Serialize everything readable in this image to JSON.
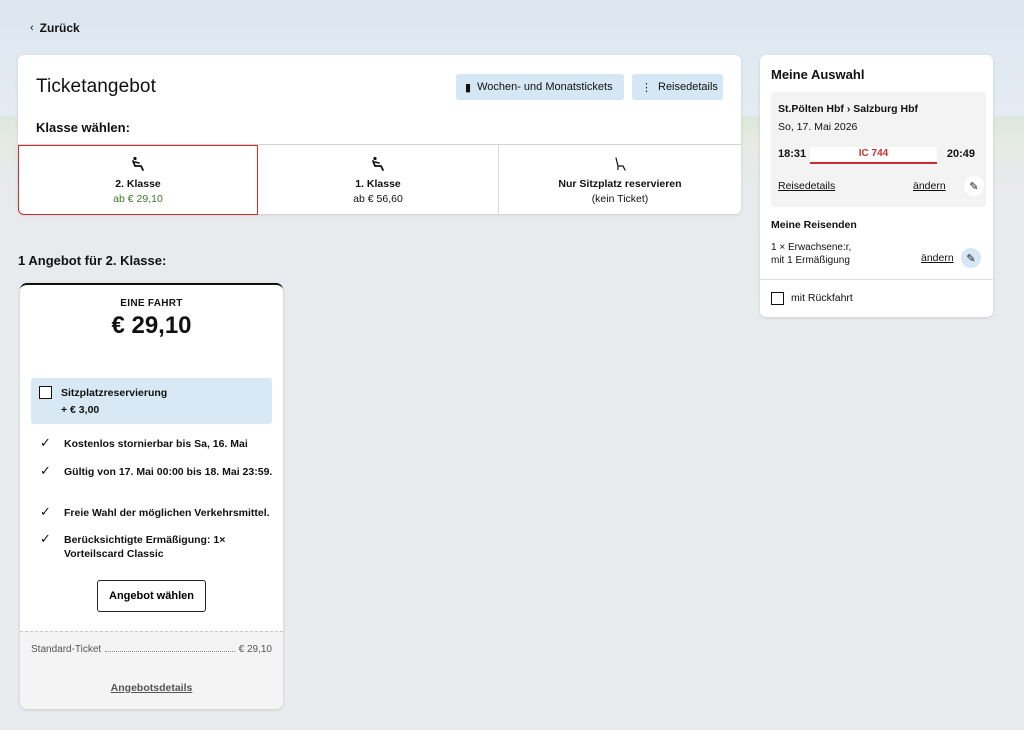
{
  "nav": {
    "back_label": "Zurück",
    "back_icon": "chevron-left-icon"
  },
  "ticket": {
    "title": "Ticketangebot",
    "weekly_button": "Wochen- und Monatstickets",
    "weekly_icon": "ticket-book-icon",
    "details_button": "Reisedetails",
    "details_icon": "route-vertical-icon",
    "class_label": "Klasse wählen:",
    "classes": [
      {
        "name": "2. Klasse",
        "price": "ab € 29,10",
        "icon": "seat-icon",
        "selected": true
      },
      {
        "name": "1. Klasse",
        "price": "ab € 56,60",
        "icon": "seat-icon",
        "selected": false
      },
      {
        "name": "Nur Sitzplatz reservieren",
        "price": "(kein Ticket)",
        "icon": "seat-outline-icon",
        "selected": false
      }
    ]
  },
  "offers": {
    "heading": "1 Angebot für 2. Klasse:",
    "card": {
      "type": "EINE FAHRT",
      "price": "€ 29,10",
      "seat_reservation_label": "Sitzplatzreservierung",
      "seat_reservation_price": "+ € 3,00",
      "features": [
        "Kostenlos stornierbar bis Sa, 16. Mai",
        "Gültig von 17. Mai 00:00 bis 18. Mai 23:59.",
        "Freie Wahl der möglichen Verkehrsmittel.",
        "Berücksichtigte Ermäßigung: 1× Vorteilscard Classic"
      ],
      "choose_button": "Angebot wählen",
      "standard_label": "Standard-Ticket",
      "standard_price": "€ 29,10",
      "details_link": "Angebotsdetails"
    }
  },
  "selection": {
    "title": "Meine Auswahl",
    "route": "St.Pölten Hbf › Salzburg Hbf",
    "date": "So, 17. Mai 2026",
    "departure": "18:31",
    "arrival": "20:49",
    "train": "IC 744",
    "trip_details_link": "Reisedetails",
    "change_link": "ändern",
    "edit_icon": "pencil-icon",
    "travellers_title": "Meine Reisenden",
    "travellers_line1": "1 × Erwachsene:r,",
    "travellers_line2": "mit 1 Ermäßigung",
    "travellers_change": "ändern",
    "return_label": "mit Rückfahrt"
  },
  "colors": {
    "accent_red": "#c8302f",
    "price_green": "#3c7a2a",
    "light_blue": "#d5e7f4"
  }
}
